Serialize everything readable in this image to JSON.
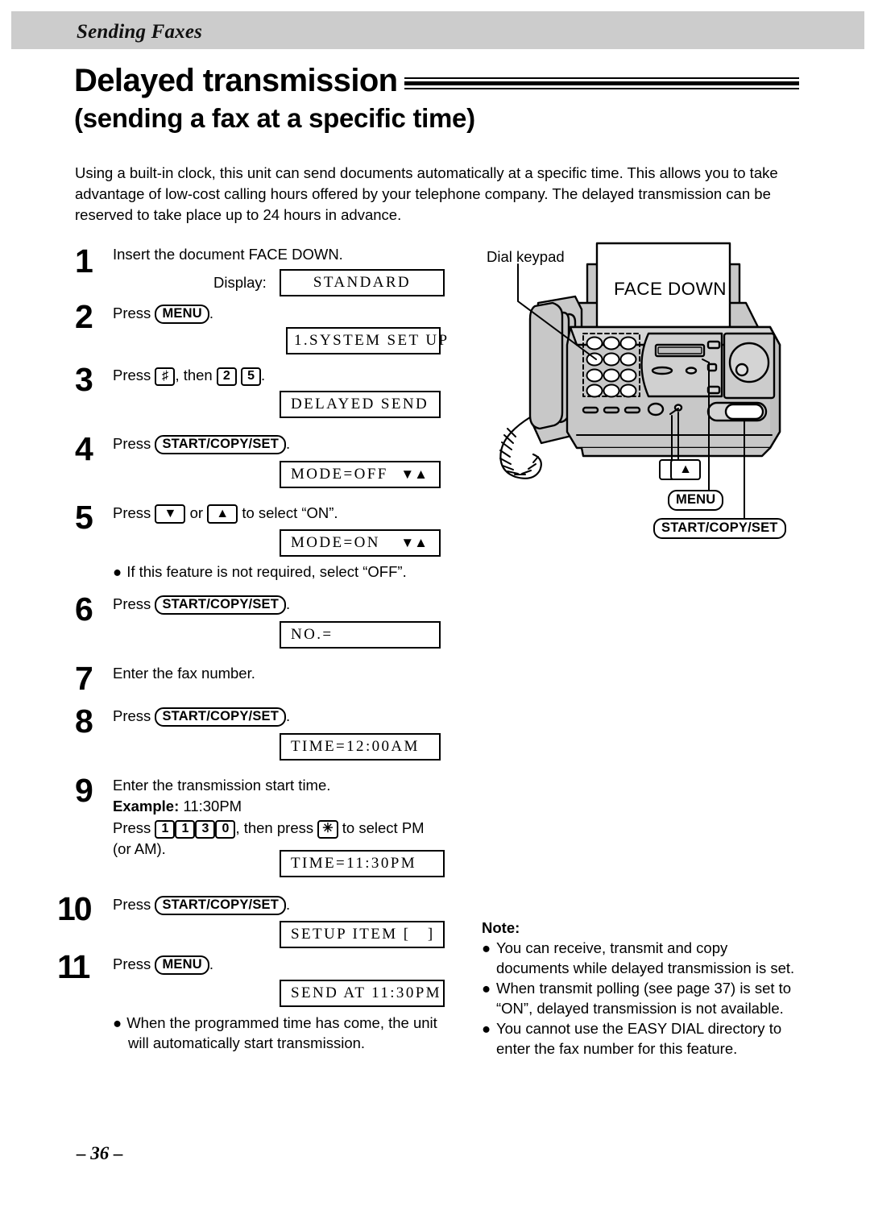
{
  "header": {
    "chapter": "Sending Faxes"
  },
  "title": {
    "main": "Delayed transmission",
    "sub": "(sending a fax at a specific time)"
  },
  "intro": "Using a built-in clock, this unit can send documents automatically at a specific time. This allows you to take advantage of low-cost calling hours offered by your telephone company. The delayed transmission can be reserved to take place up to 24 hours in advance.",
  "labels": {
    "display_label": "Display:",
    "press": "Press",
    "then": ", then",
    "or": "or",
    "period": "."
  },
  "steps": {
    "s1": {
      "num": "1",
      "text": "Insert the document FACE DOWN."
    },
    "s2": {
      "num": "2",
      "press": "Press",
      "key": "MENU",
      "end": "."
    },
    "s3": {
      "num": "3",
      "press": "Press",
      "key1": "♯",
      "mid": ", then",
      "key2": "2",
      "key3": "5",
      "end": "."
    },
    "s4": {
      "num": "4",
      "press": "Press",
      "key": "START/COPY/SET",
      "end": "."
    },
    "s5": {
      "num": "5",
      "press": "Press",
      "key_down": "▼",
      "or": "or",
      "key_up": "▲",
      "tail": "to select “ON”.",
      "bullet": "If this feature is not required, select “OFF”."
    },
    "s6": {
      "num": "6",
      "press": "Press",
      "key": "START/COPY/SET",
      "end": "."
    },
    "s7": {
      "num": "7",
      "text": "Enter the fax number."
    },
    "s8": {
      "num": "8",
      "press": "Press",
      "key": "START/COPY/SET",
      "end": "."
    },
    "s9": {
      "num": "9",
      "line1": "Enter the transmission start time.",
      "example_label": "Example:",
      "example_value": "11:30PM",
      "press": "Press",
      "k1": "1",
      "k2": "1",
      "k3": "3",
      "k4": "0",
      "mid": ", then press",
      "kstar": "✳",
      "tail": "to select PM",
      "line4": "(or AM)."
    },
    "s10": {
      "num": "10",
      "press": "Press",
      "key": "START/COPY/SET",
      "end": "."
    },
    "s11": {
      "num": "11",
      "press": "Press",
      "key": "MENU",
      "end": ".",
      "bullet1": "When the programmed time has come, the unit",
      "bullet2": "will automatically start transmission."
    }
  },
  "displays": {
    "d1": "STANDARD",
    "d2": "1.SYSTEM SET UP",
    "d3": "DELAYED SEND",
    "d4": "MODE=OFF",
    "d4_arrows": "▼▲",
    "d5": "MODE=ON",
    "d5_arrows": "▼▲",
    "d6": "NO.=",
    "d7": "TIME=12:00AM",
    "d8": "TIME=11:30PM",
    "d9": "SETUP ITEM [   ]",
    "d10": "SEND AT 11:30PM"
  },
  "note": {
    "heading": "Note:",
    "items": [
      "You can receive, transmit and copy documents while delayed transmission is set.",
      "When transmit polling (see page 37) is set to “ON”, delayed transmission is not available.",
      "You cannot use the EASY DIAL directory to enter the fax number for this feature."
    ]
  },
  "illustration": {
    "dial_keypad_label": "Dial keypad",
    "face_down_label": "FACE DOWN",
    "callout_down": "▼",
    "callout_up": "▲",
    "callout_menu": "MENU",
    "callout_start": "START/COPY/SET"
  },
  "footer": {
    "page_number": "– 36 –"
  },
  "colors": {
    "header_gray": "#cccccc",
    "body_gray": "#c8c8c8",
    "ink": "#000000"
  }
}
